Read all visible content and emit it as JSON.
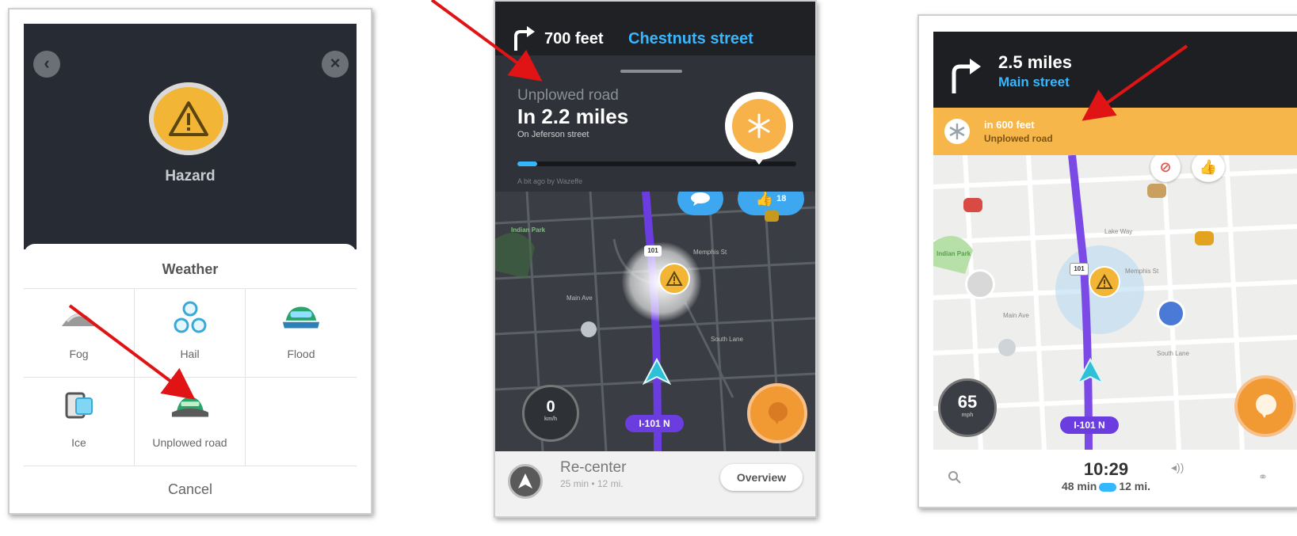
{
  "report_screen": {
    "hazard_label": "Hazard",
    "sheet_title": "Weather",
    "options": [
      {
        "label": "Fog",
        "icon": "fog-icon"
      },
      {
        "label": "Hail",
        "icon": "hail-icon"
      },
      {
        "label": "Flood",
        "icon": "flood-icon"
      },
      {
        "label": "Ice",
        "icon": "ice-icon"
      },
      {
        "label": "Unplowed road",
        "icon": "unplowed-road-icon"
      }
    ],
    "cancel_label": "Cancel"
  },
  "nav_screen_1": {
    "distance": "700 feet",
    "street": "Chestnuts street",
    "alert_type": "Unplowed road",
    "alert_distance": "In 2.2 miles",
    "alert_street": "On Jeferson street",
    "alert_meta": "A bit ago by Wazeffe",
    "alert_progress_percent": 7,
    "thumbs_count": "18",
    "speed": "0",
    "speed_unit": "km/h",
    "route_label": "I-101 N",
    "recenter_title": "Re-center",
    "recenter_sub": "25 min • 12 mi.",
    "overview_label": "Overview",
    "map_labels": [
      "Indian Park",
      "Memphis St",
      "Main Ave",
      "South Lane",
      "101"
    ]
  },
  "nav_screen_2": {
    "distance": "2.5 miles",
    "street": "Main street",
    "alert_distance": "in 600 feet",
    "alert_type": "Unplowed road",
    "speed": "65",
    "speed_unit": "mph",
    "route_label": "I-101 N",
    "time": "10:29",
    "eta_minutes": "48 min",
    "eta_distance": "12 mi.",
    "map_labels": [
      "Lake Way",
      "Indian Park",
      "Memphis St",
      "Main Ave",
      "South Lane",
      "101"
    ]
  },
  "colors": {
    "waze_blue": "#38b7ff",
    "hazard_yellow": "#f2b535",
    "route_purple": "#6b3de0",
    "annotation_red": "#e01414"
  }
}
